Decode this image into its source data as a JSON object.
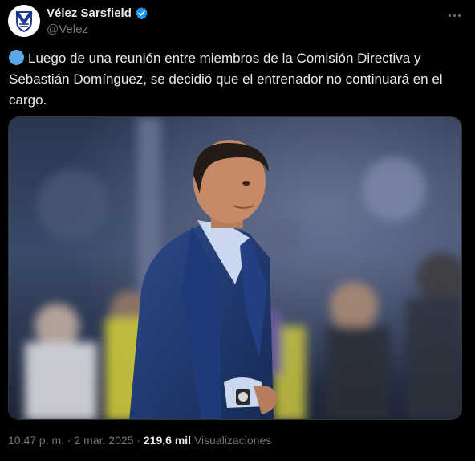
{
  "author": {
    "display_name": "Vélez Sarsfield",
    "handle": "@Velez",
    "verified": true,
    "avatar_icon": "velez-crest-icon",
    "accent_color": "#1d9bf0"
  },
  "tweet": {
    "leading_emoji": "blue-circle",
    "text": "Luego de una reunión entre miembros de la Comisión Directiva y Sebastián Domínguez, se decidió que el entrenador no continuará en el cargo."
  },
  "media": {
    "type": "photo",
    "subject": "coach-in-navy-suit-stadium"
  },
  "meta": {
    "time": "10:47 p. m.",
    "separator": "·",
    "date": "2 mar. 2025",
    "views_count": "219,6 mil",
    "views_label": "Visualizaciones"
  },
  "colors": {
    "background": "#000000",
    "text": "#e7e9ea",
    "muted": "#71767b",
    "velez_blue": "#1e3a8a"
  }
}
